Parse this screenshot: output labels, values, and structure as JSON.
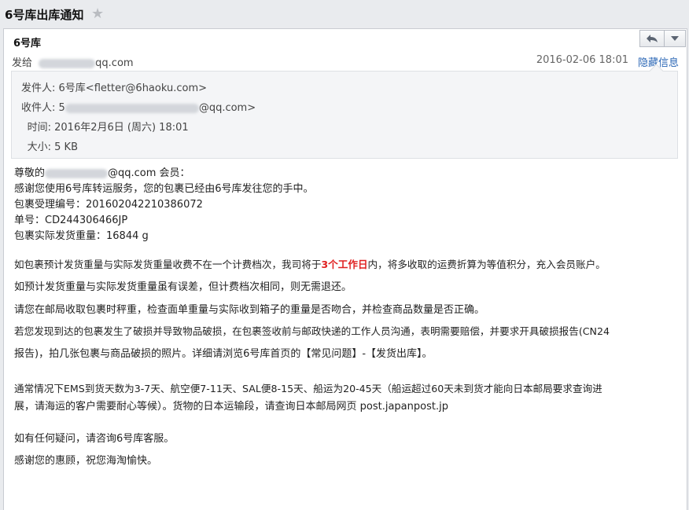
{
  "subject": "6号库出库通知",
  "header": {
    "sender_name": "6号库",
    "to_prefix": "发给",
    "to_suffix": "qq.com",
    "date": "2016-02-06 18:01",
    "hide_label": "隐藏信息",
    "reply_icon": "reply-arrow-icon",
    "more_icon": "chevron-down-icon"
  },
  "details": {
    "from_label": "发件人:",
    "from_value": "6号库<fletter@6haoku.com>",
    "to_label": "收件人:",
    "to_value_start": "5",
    "to_value_end": "@qq.com>",
    "time_label": "时间:",
    "time_value": "2016年2月6日 (周六) 18:01",
    "size_label": "大小:",
    "size_value": "5 KB"
  },
  "body": {
    "greeting_prefix": "尊敬的",
    "greeting_suffix": "@qq.com 会员：",
    "line1": "感谢您使用6号库转运服务，您的包裹已经由6号库发往您的手中。",
    "line2": "包裹受理编号：201602042210386072",
    "line3": "单号：CD244306466JP",
    "line4": "包裹实际发货重量：16844 g",
    "para1_a": "如包裹预计发货重量与实际发货重量收费不在一个计费档次，我司将于",
    "para1_highlight": "3个工作日",
    "para1_b": "内，将多收取的运费折算为等值积分，充入会员账户。",
    "para2": "如预计发货重量与实际发货重量虽有误差，但计费档次相同，则无需退还。",
    "para3": "请您在邮局收取包裹时秤重，检查面单重量与实际收到箱子的重量是否吻合，并检查商品数量是否正确。",
    "para4_line1": "若您发现到达的包裹发生了破损并导致物品破损，在包裹签收前与邮政快递的工作人员沟通，表明需要赔偿，并要求开具破损报告(CN24",
    "para4_line2": "报告)，拍几张包裹与商品破损的照片。详细请浏览6号库首页的【常见问题】-【发货出库】。",
    "para5_line1": "通常情况下EMS到货天数为3-7天、航空便7-11天、SAL便8-15天、船运为20-45天（船运超过60天未到货才能向日本邮局要求查询进",
    "para5_line2": "展，请海运的客户需要耐心等候）。货物的日本运输段，请查询日本邮局网页 post.japanpost.jp",
    "para6": "如有任何疑问，请咨询6号库客服。",
    "para7": "感谢您的惠顾，祝您海淘愉快。"
  },
  "colors": {
    "accent_link": "#2a66b5",
    "highlight": "#e02020"
  }
}
